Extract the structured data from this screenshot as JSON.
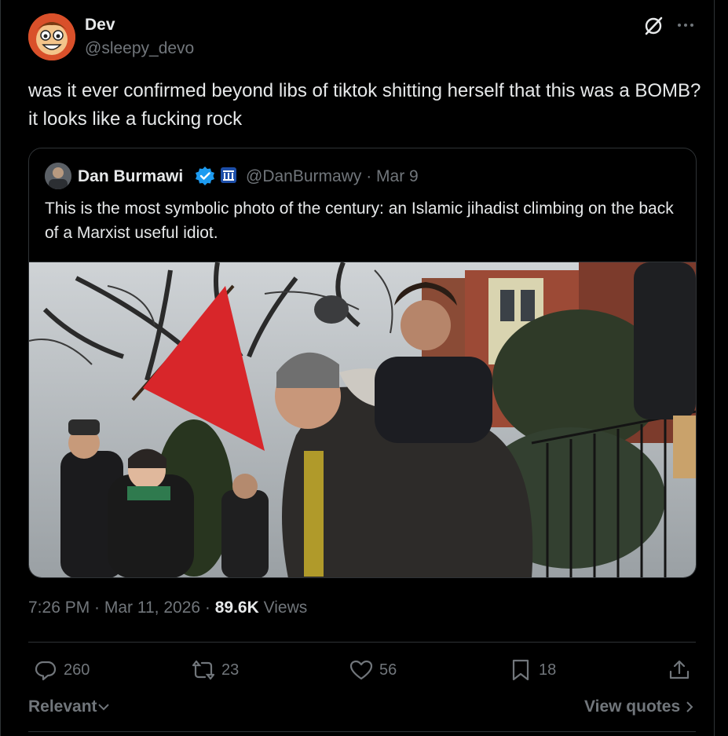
{
  "post": {
    "author_name": "Dev",
    "author_handle": "@sleepy_devo",
    "text": "was it ever confirmed beyond libs of tiktok shitting herself that this was a BOMB? it looks like a fucking rock"
  },
  "quote": {
    "author_name": "Dan Burmawi",
    "handle_date": "@DanBurmawy · Mar 9",
    "text": "This is the most symbolic photo of the century: an Islamic jihadist climbing on the back of a Marxist useful idiot."
  },
  "meta": {
    "time_date": "7:26 PM · Mar 11, 2026 · ",
    "views_count": "89.6K",
    "views_label": " Views"
  },
  "actions": {
    "replies": "260",
    "reposts": "23",
    "likes": "56",
    "bookmarks": "18"
  },
  "footer": {
    "sort_label": "Relevant",
    "view_quotes_label": "View quotes"
  },
  "colors": {
    "background": "#000000",
    "text_primary": "#e7e9ea",
    "text_secondary": "#71767b",
    "border": "#2f3336",
    "verified_blue": "#1d9bf0",
    "flag_red": "#d8262a"
  }
}
